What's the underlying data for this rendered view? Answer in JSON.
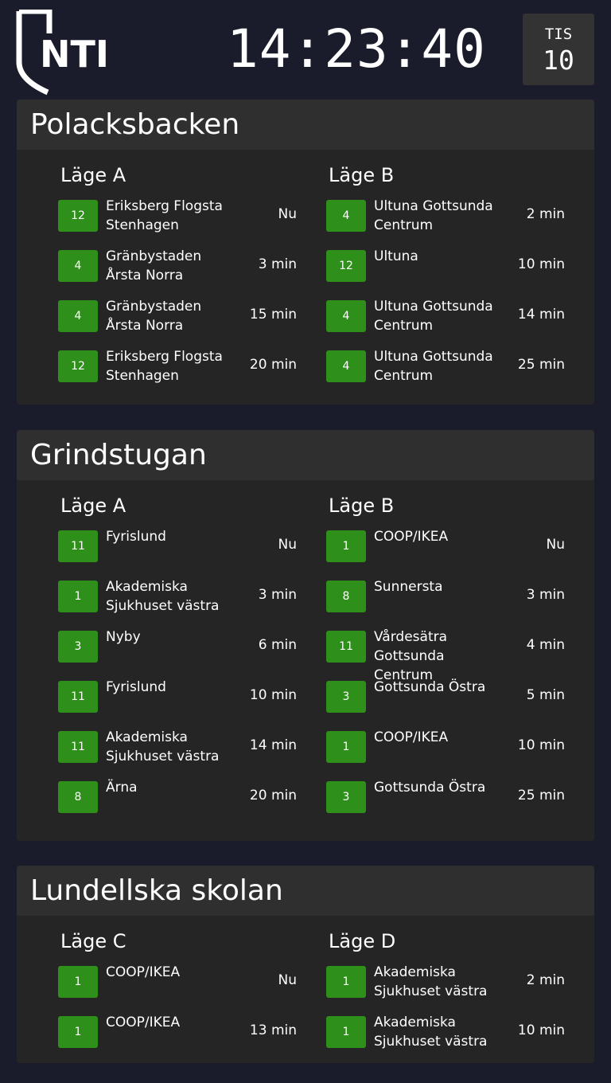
{
  "header": {
    "logo_text": "NTI",
    "clock": "14:23:40",
    "weekday": "TIS",
    "day": "10"
  },
  "colors": {
    "background": "#1b1c2b",
    "card": "#252525",
    "card_header": "#2f2f2f",
    "line_badge": "#2f8f1b"
  },
  "stops": [
    {
      "name": "Polacksbacken",
      "columns": [
        {
          "label": "Läge A",
          "departures": [
            {
              "line": "12",
              "destination": "Eriksberg Flogsta Stenhagen",
              "time": "Nu"
            },
            {
              "line": "4",
              "destination": "Gränbystaden Årsta Norra",
              "time": "3 min"
            },
            {
              "line": "4",
              "destination": "Gränbystaden Årsta Norra",
              "time": "15 min"
            },
            {
              "line": "12",
              "destination": "Eriksberg Flogsta Stenhagen",
              "time": "20 min"
            }
          ]
        },
        {
          "label": "Läge B",
          "departures": [
            {
              "line": "4",
              "destination": "Ultuna Gottsunda Centrum",
              "time": "2 min"
            },
            {
              "line": "12",
              "destination": "Ultuna",
              "time": "10 min"
            },
            {
              "line": "4",
              "destination": "Ultuna Gottsunda Centrum",
              "time": "14 min"
            },
            {
              "line": "4",
              "destination": "Ultuna Gottsunda Centrum",
              "time": "25 min"
            }
          ]
        }
      ]
    },
    {
      "name": "Grindstugan",
      "columns": [
        {
          "label": "Läge A",
          "departures": [
            {
              "line": "11",
              "destination": "Fyrislund",
              "time": "Nu"
            },
            {
              "line": "1",
              "destination": "Akademiska Sjukhuset västra",
              "time": "3 min"
            },
            {
              "line": "3",
              "destination": "Nyby",
              "time": "6 min"
            },
            {
              "line": "11",
              "destination": "Fyrislund",
              "time": "10 min"
            },
            {
              "line": "11",
              "destination": "Akademiska Sjukhuset västra",
              "time": "14 min"
            },
            {
              "line": "8",
              "destination": "Ärna",
              "time": "20 min"
            }
          ]
        },
        {
          "label": "Läge B",
          "departures": [
            {
              "line": "1",
              "destination": "COOP/IKEA",
              "time": "Nu"
            },
            {
              "line": "8",
              "destination": "Sunnersta",
              "time": "3 min"
            },
            {
              "line": "11",
              "destination": "Vårdesätra Gottsunda Centrum",
              "time": "4 min"
            },
            {
              "line": "3",
              "destination": "Gottsunda Östra",
              "time": "5 min"
            },
            {
              "line": "1",
              "destination": "COOP/IKEA",
              "time": "10 min"
            },
            {
              "line": "3",
              "destination": "Gottsunda Östra",
              "time": "25 min"
            }
          ]
        }
      ]
    },
    {
      "name": "Lundellska skolan",
      "columns": [
        {
          "label": "Läge C",
          "departures": [
            {
              "line": "1",
              "destination": "COOP/IKEA",
              "time": "Nu"
            },
            {
              "line": "1",
              "destination": "COOP/IKEA",
              "time": "13 min"
            }
          ]
        },
        {
          "label": "Läge D",
          "departures": [
            {
              "line": "1",
              "destination": "Akademiska Sjukhuset västra",
              "time": "2 min"
            },
            {
              "line": "1",
              "destination": "Akademiska Sjukhuset västra",
              "time": "10 min"
            }
          ]
        }
      ]
    }
  ]
}
